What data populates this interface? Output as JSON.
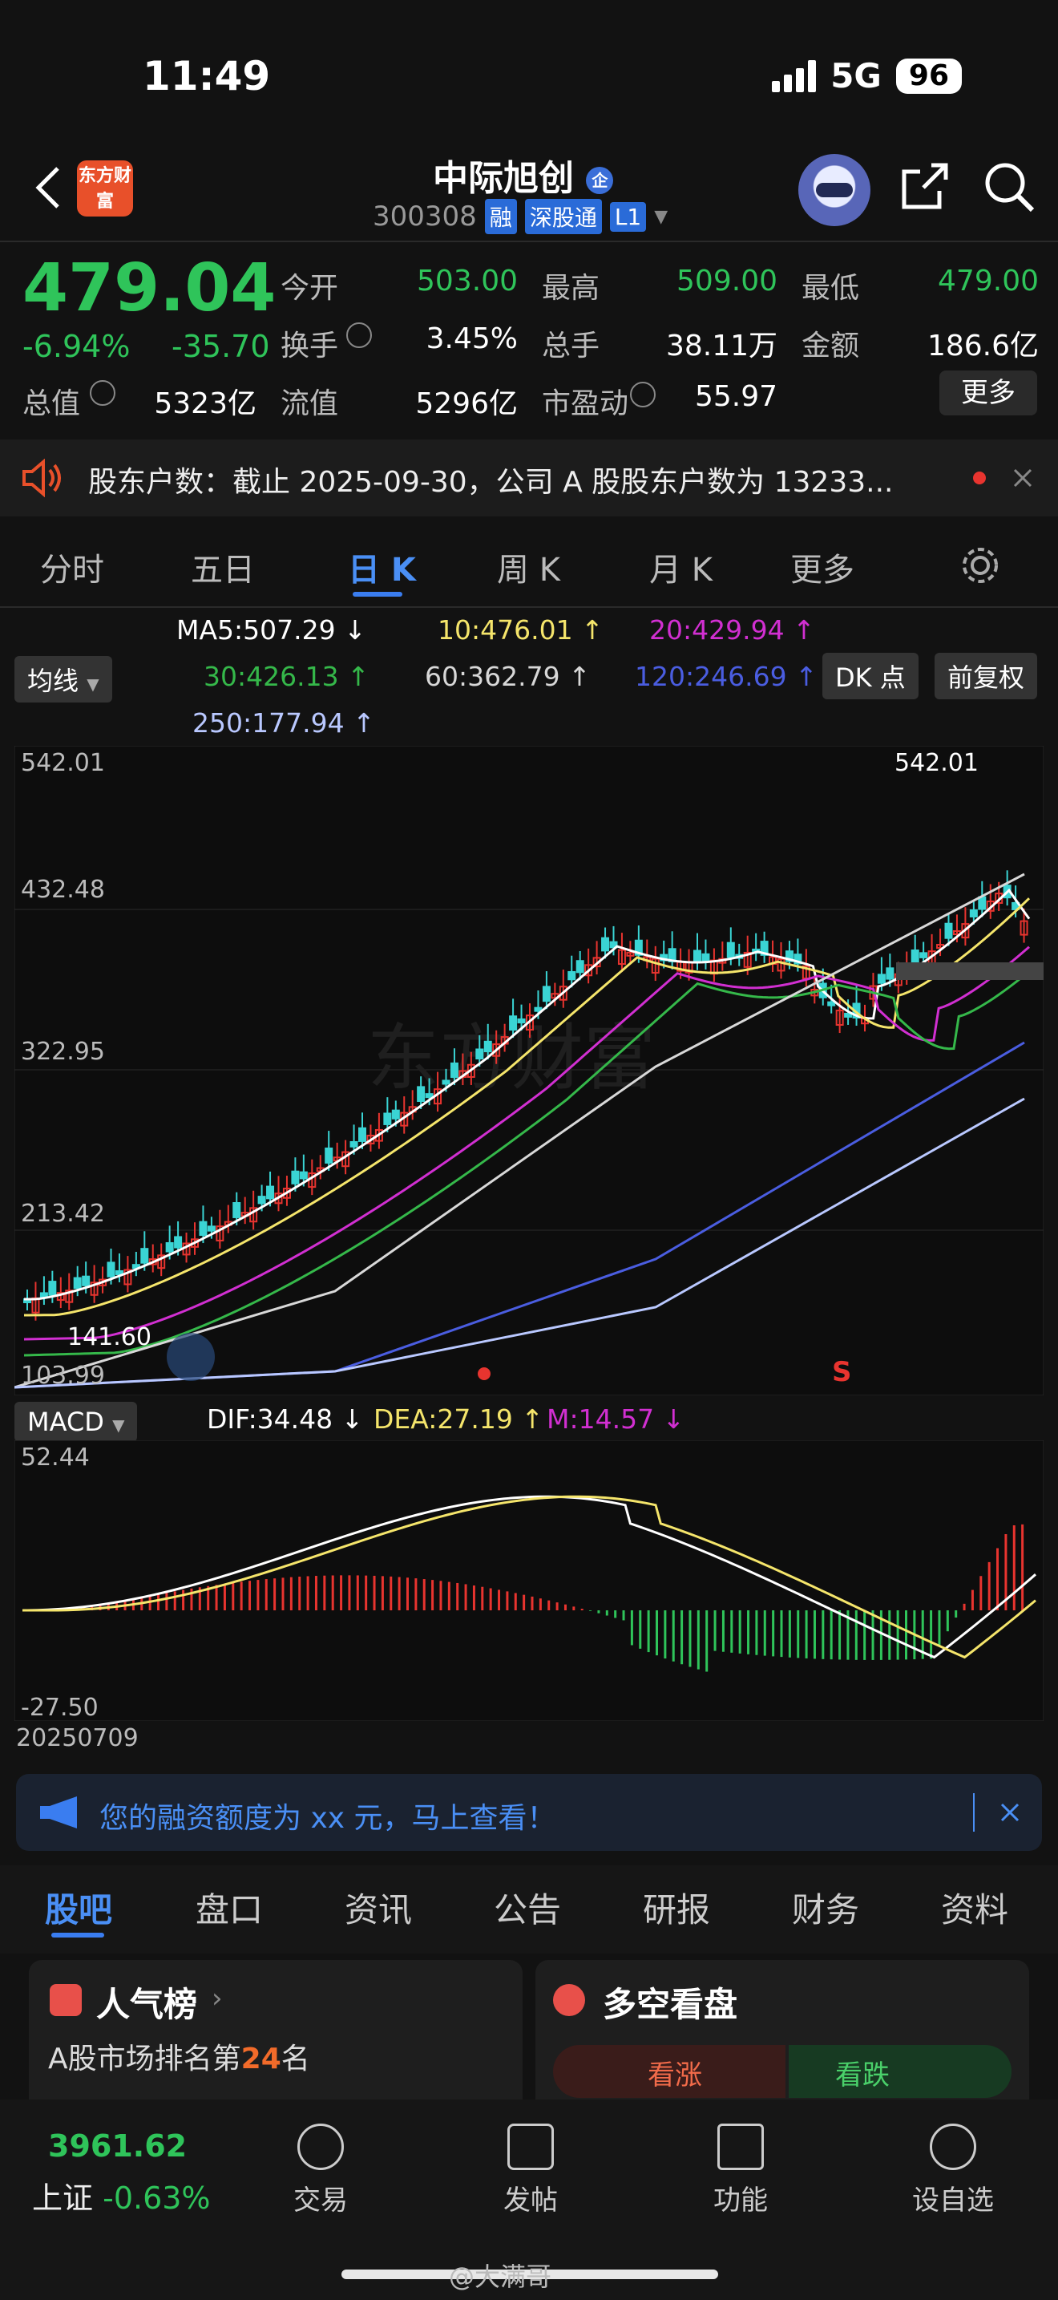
{
  "status": {
    "time": "11:49",
    "network": "5G",
    "battery": "96"
  },
  "header": {
    "name": "中际旭创",
    "code": "300308",
    "badges": [
      "融",
      "深股通",
      "L1"
    ],
    "logo_text": "东方财富"
  },
  "quote": {
    "price": "479.04",
    "change_pct": "-6.94%",
    "change": "-35.70",
    "open_label": "今开",
    "open": "503.00",
    "high_label": "最高",
    "high": "509.00",
    "low_label": "最低",
    "low": "479.00",
    "turnover_label": "换手",
    "turnover": "3.45%",
    "volume_label": "总手",
    "volume": "38.11万",
    "amount_label": "金额",
    "amount": "186.6亿",
    "mktcap_label": "总值",
    "mktcap": "5323亿",
    "float_label": "流值",
    "float": "5296亿",
    "pe_label": "市盈动",
    "pe": "55.97",
    "more": "更多"
  },
  "notice": {
    "text": "股东户数：截止 2025-09-30，公司 A 股股东户数为 13233..."
  },
  "period_tabs": [
    "分时",
    "五日",
    "日 K",
    "周 K",
    "月 K",
    "更多"
  ],
  "ma": {
    "selector": "均线",
    "ma5": "MA5:507.29 ↓",
    "ma10": "10:476.01 ↑",
    "ma20": "20:429.94 ↑",
    "ma30": "30:426.13 ↑",
    "ma60": "60:362.79 ↑",
    "ma120": "120:246.69 ↑",
    "ma250": "250:177.94 ↑",
    "dk": "DK 点",
    "adjust": "前复权",
    "colors": {
      "ma5": "#ffffff",
      "ma10": "#f5e56b",
      "ma20": "#d12fd1",
      "ma30": "#35b84a",
      "ma60": "#d8d8d8",
      "ma120": "#4a5de0",
      "ma250": "#b9c8ff"
    }
  },
  "kchart": {
    "y_ticks": [
      "542.01",
      "432.48",
      "322.95",
      "213.42",
      "103.99"
    ],
    "max_label": "542.01",
    "min_label": "141.60",
    "signal": "S"
  },
  "macd": {
    "selector": "MACD",
    "dif": "DIF:34.48 ↓",
    "dea": "DEA:27.19 ↑",
    "m": "M:14.57 ↓",
    "y_top": "52.44",
    "y_bottom": "-27.50",
    "date": "20250709"
  },
  "ad_banner": {
    "text": "您的融资额度为 xx 元，马上查看！"
  },
  "bottom_tabs": [
    "股吧",
    "盘口",
    "资讯",
    "公告",
    "研报",
    "财务",
    "资料"
  ],
  "cards": {
    "popularity_title": "人气榜",
    "popularity_line1_pre": "A股市场排名第",
    "popularity_rank": "24",
    "popularity_line1_post": "名",
    "longshort_title": "多空看盘",
    "up_label": "看涨",
    "down_label": "看跌"
  },
  "footer": {
    "index_value": "3961.62",
    "index_name": "上证",
    "index_change": "-0.63%",
    "items": [
      "交易",
      "发帖",
      "功能",
      "设自选"
    ]
  },
  "watermark": "@大满哥"
}
